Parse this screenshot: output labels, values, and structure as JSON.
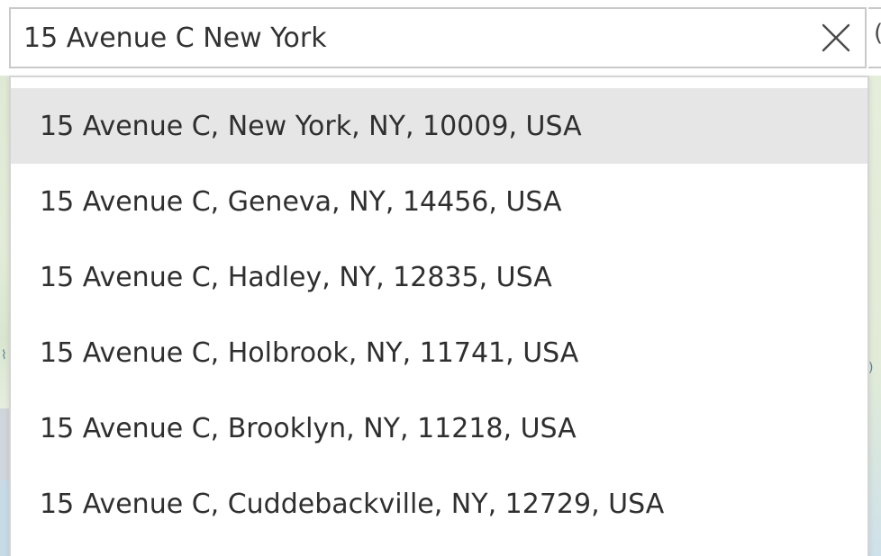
{
  "search": {
    "value": "15 Avenue C New York",
    "clear_icon": "close-icon",
    "next_control_glyph": "("
  },
  "suggestions": [
    {
      "label": "15 Avenue C, New York, NY, 10009, USA",
      "active": true
    },
    {
      "label": "15 Avenue C, Geneva, NY, 14456, USA",
      "active": false
    },
    {
      "label": "15 Avenue C, Hadley, NY, 12835, USA",
      "active": false
    },
    {
      "label": "15 Avenue C, Holbrook, NY, 11741, USA",
      "active": false
    },
    {
      "label": "15 Avenue C, Brooklyn, NY, 11218, USA",
      "active": false
    },
    {
      "label": "15 Avenue C, Cuddebackville, NY, 12729, USA",
      "active": false
    }
  ],
  "colors": {
    "active_row": "#e6e6e6",
    "border": "#c9c9c9",
    "text": "#2f2f2f"
  }
}
